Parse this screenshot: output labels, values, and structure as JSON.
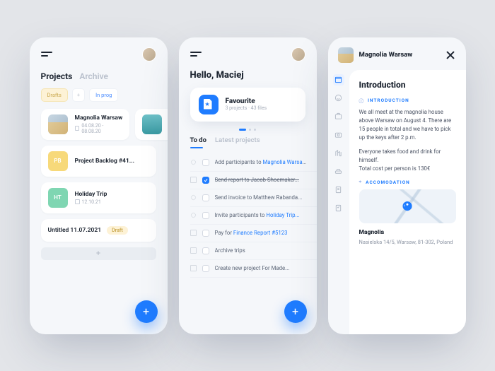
{
  "colors": {
    "accent": "#1f7cff",
    "draft": "#fdf2d6"
  },
  "screen1": {
    "tabs": {
      "projects": "Projects",
      "archive": "Archive"
    },
    "chips": {
      "drafts": "Drafts",
      "plus": "+",
      "inprog": "In prog"
    },
    "items": [
      {
        "badge_text": "",
        "title": "Magnolia Warsaw",
        "meta": "04.08.20 - 08.08.20"
      },
      {
        "badge_text": "PB",
        "title": "Project Backlog #41...",
        "meta": ""
      },
      {
        "badge_text": "HT",
        "title": "Holiday Trip",
        "meta": "12.10.21"
      }
    ],
    "untitled": "Untitled 11.07.2021",
    "draft_label": "Draft",
    "add": "+"
  },
  "screen2": {
    "greeting": "Hello, Maciej",
    "fav": {
      "title": "Favourite",
      "meta": "3 projects · 43 files"
    },
    "tabs": {
      "todo": "To do",
      "latest": "Latest projects"
    },
    "todos": [
      {
        "checked": false,
        "t1": "Add participants to ",
        "link": "Magnolia Warsa...",
        "t2": ""
      },
      {
        "checked": true,
        "t1": "Send report to Jacob Shoemaker...",
        "link": "",
        "t2": ""
      },
      {
        "checked": false,
        "t1": "Send invoice to Matthew Rabanda...",
        "link": "",
        "t2": ""
      },
      {
        "checked": false,
        "t1": "Invite participants to ",
        "link": "Holiday Trip...",
        "t2": ""
      },
      {
        "checked": false,
        "t1": "Pay for ",
        "link": "Finance Report #5123",
        "t2": ""
      },
      {
        "checked": false,
        "t1": "Archive trips",
        "link": "",
        "t2": ""
      },
      {
        "checked": false,
        "t1": "Create new project For Made...",
        "link": "",
        "t2": ""
      }
    ]
  },
  "screen3": {
    "title": "Magnolia Warsaw",
    "heading": "Introduction",
    "sect_intro": "INTRODUCTION",
    "p1": "We all meet at the magnolia house above Warsaw on August 4. There are 15 people in total and we have to pick up the keys after 2 p.m.",
    "p2": "Everyone takes food and drink for himself.",
    "p3": "Total cost per person is 130€",
    "sect_accom": "ACCOMODATION",
    "loc_name": "Magnolia",
    "addr": "Nasielska 14/5, Warsaw, 81-302, Poland"
  }
}
